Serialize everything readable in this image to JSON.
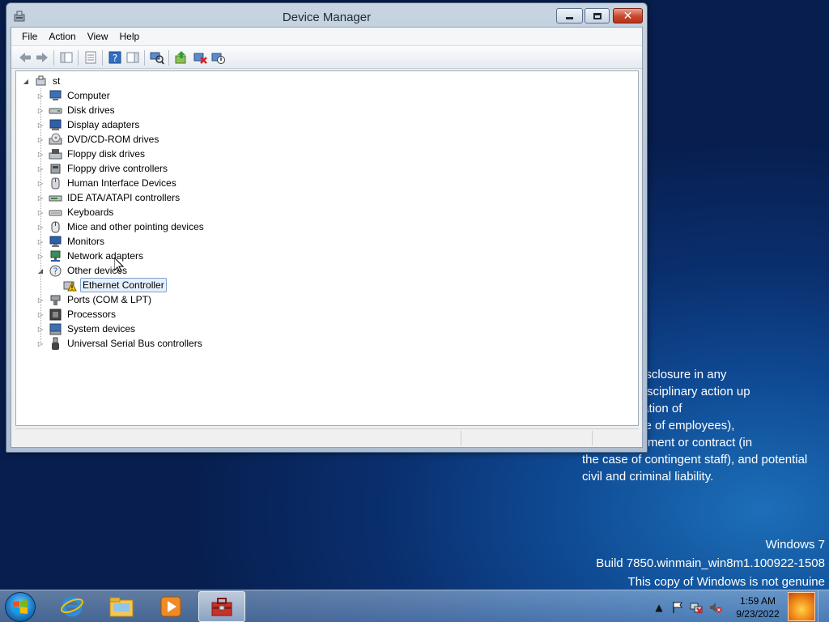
{
  "window": {
    "title": "Device Manager",
    "close_glyph": "✕"
  },
  "menu": [
    "File",
    "Action",
    "View",
    "Help"
  ],
  "toolbar_icons": [
    "back-arrow-icon",
    "forward-arrow-icon",
    "show-hide-console-tree-icon",
    "properties-icon",
    "help-icon",
    "action-pane-icon",
    "scan-hardware-icon",
    "update-driver-icon",
    "uninstall-icon",
    "disable-device-icon"
  ],
  "tree": {
    "root": "st",
    "categories": [
      {
        "label": "Computer",
        "icon": "computer-icon",
        "expanded": false
      },
      {
        "label": "Disk drives",
        "icon": "disk-drive-icon",
        "expanded": false
      },
      {
        "label": "Display adapters",
        "icon": "display-adapter-icon",
        "expanded": false
      },
      {
        "label": "DVD/CD-ROM drives",
        "icon": "dvd-drive-icon",
        "expanded": false
      },
      {
        "label": "Floppy disk drives",
        "icon": "floppy-disk-icon",
        "expanded": false
      },
      {
        "label": "Floppy drive controllers",
        "icon": "floppy-controller-icon",
        "expanded": false
      },
      {
        "label": "Human Interface Devices",
        "icon": "hid-icon",
        "expanded": false
      },
      {
        "label": "IDE ATA/ATAPI controllers",
        "icon": "ide-controller-icon",
        "expanded": false
      },
      {
        "label": "Keyboards",
        "icon": "keyboard-icon",
        "expanded": false
      },
      {
        "label": "Mice and other pointing devices",
        "icon": "mouse-icon",
        "expanded": false
      },
      {
        "label": "Monitors",
        "icon": "monitor-icon",
        "expanded": false
      },
      {
        "label": "Network adapters",
        "icon": "network-adapter-icon",
        "expanded": false
      },
      {
        "label": "Other devices",
        "icon": "unknown-device-icon",
        "expanded": true,
        "children": [
          {
            "label": "Ethernet Controller",
            "icon": "warning-device-icon",
            "selected": true
          }
        ]
      },
      {
        "label": "Ports (COM & LPT)",
        "icon": "port-icon",
        "expanded": false
      },
      {
        "label": "Processors",
        "icon": "processor-icon",
        "expanded": false
      },
      {
        "label": "System devices",
        "icon": "system-device-icon",
        "expanded": false
      },
      {
        "label": "Universal Serial Bus controllers",
        "icon": "usb-icon",
        "expanded": false
      }
    ]
  },
  "desktop": {
    "disclaimer_lines": [
      "ed use or disclosure in any",
      "y result in disciplinary action up",
      "ding termination of",
      "t (in the case of employees),",
      "of an assignment or contract (in",
      "the case of contingent staff), and potential",
      "civil and criminal liability."
    ],
    "watermark": {
      "os": "Windows 7",
      "build": "Build 7850.winmain_win8m1.100922-1508",
      "genuine": "This copy of Windows is not genuine"
    }
  },
  "taskbar": {
    "pinned": [
      "internet-explorer-icon",
      "windows-explorer-icon",
      "media-player-icon",
      "device-manager-toolbox-icon"
    ],
    "tray": [
      "show-hidden-icons-icon",
      "action-center-flag-icon",
      "network-icon",
      "volume-muted-icon"
    ],
    "tray_chevron": "▲",
    "clock_time": "1:59 AM",
    "clock_date": "9/23/2022"
  },
  "colors": {
    "accent": "#3399ff",
    "selection_border": "#7da2ce",
    "warning": "#f5c400",
    "close_red": "#c9462c"
  }
}
